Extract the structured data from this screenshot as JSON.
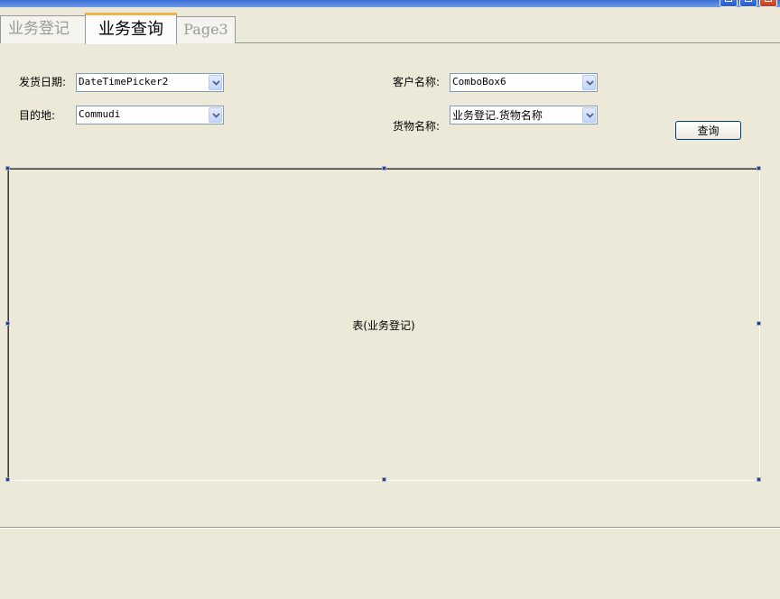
{
  "tabs": [
    {
      "label": "业务登记"
    },
    {
      "label": "业务查询"
    },
    {
      "label": "Page3"
    }
  ],
  "form": {
    "ship_date": {
      "label": "发货日期:",
      "value": "DateTimePicker2"
    },
    "destination": {
      "label": "目的地:",
      "value": "Commudi"
    },
    "customer": {
      "label": "客户名称:",
      "value": "ComboBox6"
    },
    "goods": {
      "label": "货物名称:",
      "value": "业务登记.货物名称"
    }
  },
  "query_button": {
    "label": "查询"
  },
  "grid": {
    "caption": "表(业务登记)"
  },
  "colors": {
    "background": "#ece9d8",
    "tab_active_accent": "#f0b44a",
    "border": "#7f9db9"
  }
}
